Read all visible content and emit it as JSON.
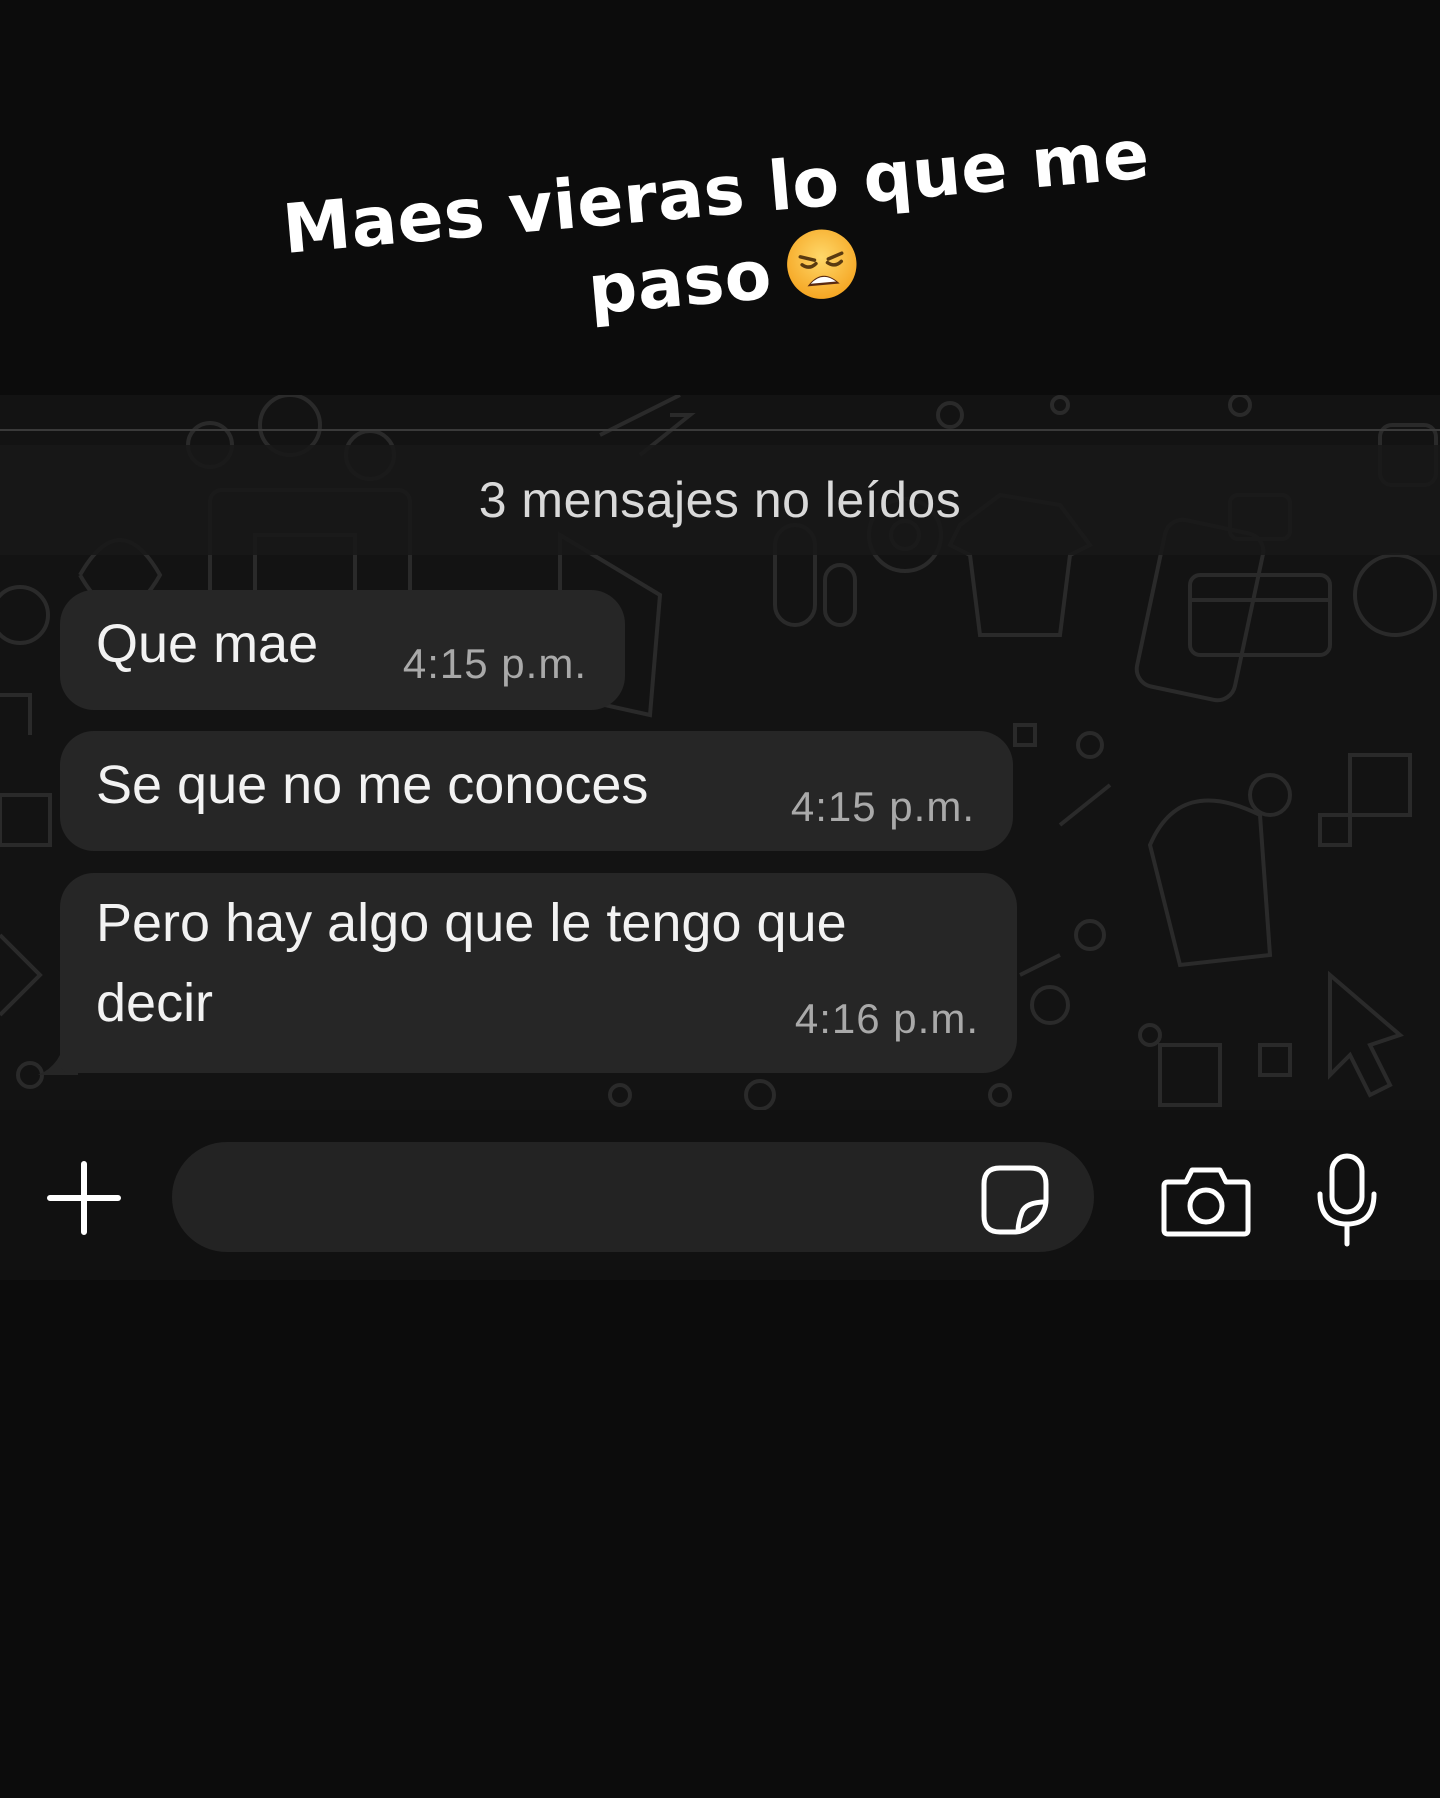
{
  "story": {
    "caption_line1": "Maes vieras lo que me",
    "caption_line2": "paso",
    "caption_emoji": "weary-face-emoji"
  },
  "chat": {
    "unread_banner": "3 mensajes no leídos",
    "messages": [
      {
        "text": "Que mae",
        "time": "4:15 p.m."
      },
      {
        "text": "Se que no me conoces",
        "time": "4:15 p.m."
      },
      {
        "text": "Pero hay algo que le tengo que decir",
        "time": "4:16 p.m."
      }
    ]
  },
  "composer": {
    "input_value": "",
    "icons": [
      "plus-icon",
      "sticker-icon",
      "camera-icon",
      "microphone-icon"
    ]
  },
  "colors": {
    "background": "#0c0c0c",
    "bubble": "#262626",
    "timestamp": "#a9a9a9",
    "input_field": "#232323"
  }
}
